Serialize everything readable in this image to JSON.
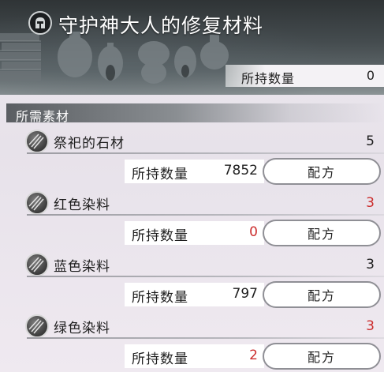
{
  "header": {
    "title": "守护神大人的修复材料",
    "owned_label": "所持数量",
    "owned_value": "0"
  },
  "section": {
    "title": "所需素材"
  },
  "materials": [
    {
      "name": "祭祀的石材",
      "required": "5",
      "owned_label": "所持数量",
      "owned": "7852",
      "recipe_label": "配方",
      "insufficient": false,
      "icon": "stone-material-icon"
    },
    {
      "name": "红色染料",
      "required": "3",
      "owned_label": "所持数量",
      "owned": "0",
      "recipe_label": "配方",
      "insufficient": true,
      "icon": "dye-material-icon"
    },
    {
      "name": "蓝色染料",
      "required": "3",
      "owned_label": "所持数量",
      "owned": "797",
      "recipe_label": "配方",
      "insufficient": false,
      "icon": "dye-material-icon"
    },
    {
      "name": "绿色染料",
      "required": "3",
      "owned_label": "所持数量",
      "owned": "2",
      "recipe_label": "配方",
      "insufficient": true,
      "icon": "dye-material-icon"
    }
  ],
  "colors": {
    "insufficient": "#cc2d2d",
    "normal": "#1e1e1e"
  }
}
